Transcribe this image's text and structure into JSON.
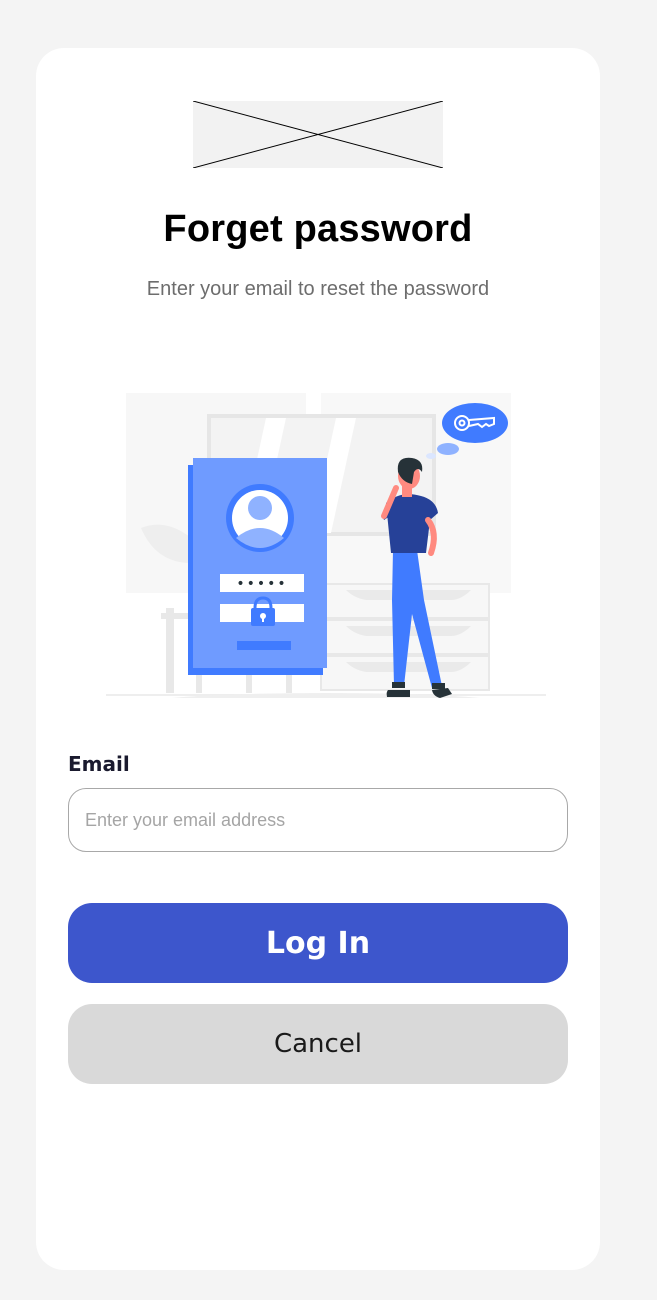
{
  "header": {
    "title": "Forget password",
    "subtitle": "Enter your email to reset the password"
  },
  "illustration": {
    "name": "forgot-password-illustration",
    "pin_dots": "•••••"
  },
  "form": {
    "email_label": "Email",
    "email_placeholder": "Enter your email address",
    "email_value": ""
  },
  "actions": {
    "login_label": "Log In",
    "cancel_label": "Cancel"
  },
  "colors": {
    "primary": "#3d56cc",
    "illustration_blue": "#407bff",
    "secondary_button": "#d9d9d9",
    "page_background": "#f4f4f4"
  }
}
